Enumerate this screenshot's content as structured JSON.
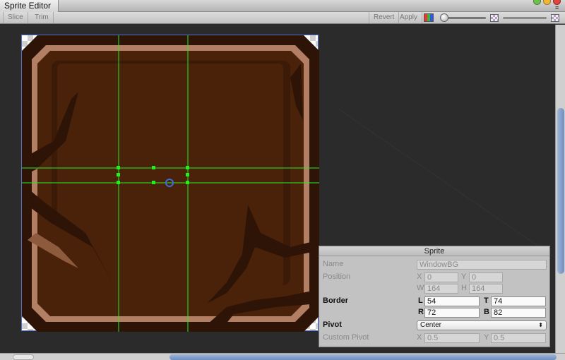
{
  "window": {
    "title": "Sprite Editor",
    "menu_icon": "menu-lines-icon"
  },
  "toolbar": {
    "slice_label": "Slice",
    "trim_label": "Trim",
    "revert_label": "Revert",
    "apply_label": "Apply",
    "color_channel_icon": "rgb-channel-icon",
    "zoom_slider_icon": "slider-icon",
    "alpha_icon": "checkerboard-icon"
  },
  "inspector": {
    "header": "Sprite",
    "name_label": "Name",
    "name_value": "WindowBG",
    "position_label": "Position",
    "x_label": "X",
    "x_value": "0",
    "y_label": "Y",
    "y_value": "0",
    "w_label": "W",
    "w_value": "164",
    "h_label": "H",
    "h_value": "164",
    "border_label": "Border",
    "l_label": "L",
    "l_value": "54",
    "t_label": "T",
    "t_value": "74",
    "r_label": "R",
    "r_value": "72",
    "b_label": "B",
    "b_value": "82",
    "pivot_label": "Pivot",
    "pivot_value": "Center",
    "custom_pivot_label": "Custom Pivot",
    "cx_label": "X",
    "cx_value": "0.5",
    "cy_label": "Y",
    "cy_value": "0.5"
  },
  "colors": {
    "border_guides": "#22ee22",
    "sprite_outline": "#5570c8",
    "wood_dark": "#2e1407",
    "wood_mid": "#4a2109",
    "wood_light": "#b27f64",
    "scroll_thumb": "#7f9cc7"
  }
}
